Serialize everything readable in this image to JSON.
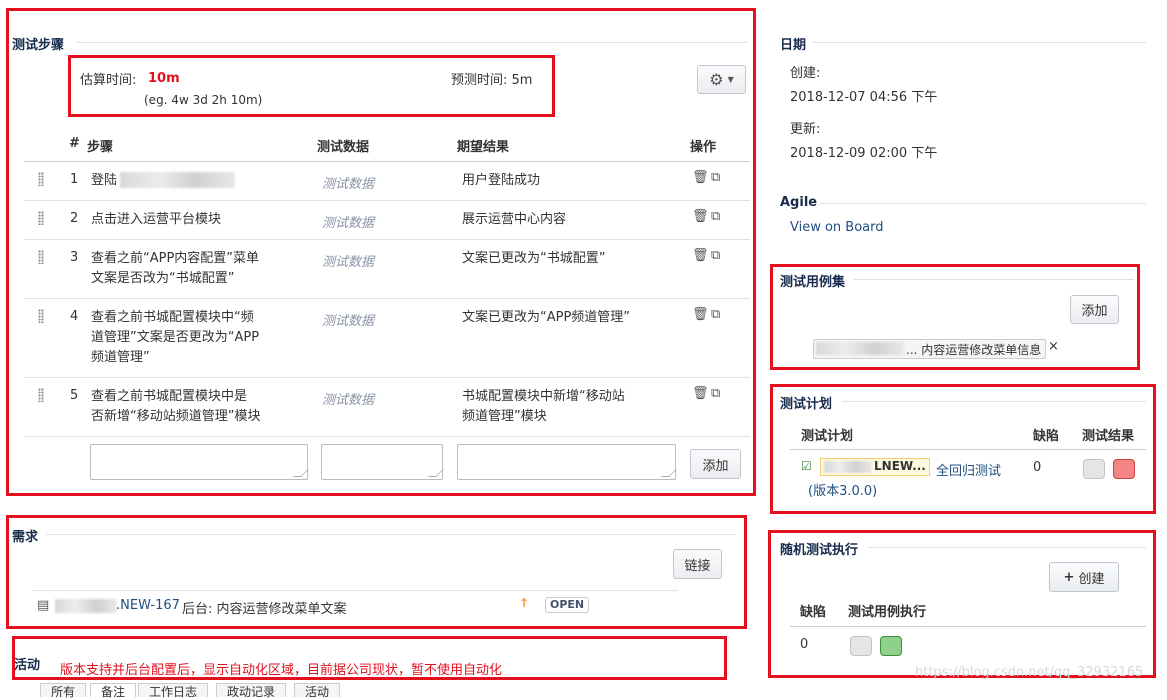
{
  "test_steps": {
    "title": "测试步骤",
    "estimate_label": "估算时间:",
    "estimate_value": "10m",
    "estimate_hint": "(eg. 4w 3d 2h 10m)",
    "forecast_label": "预测时间: 5m",
    "columns": {
      "num": "#",
      "step": "步骤",
      "data": "测试数据",
      "expected": "期望结果",
      "actions": "操作"
    },
    "rows": [
      {
        "num": "1",
        "step_lines": [
          "登陆"
        ],
        "data": "测试数据",
        "expected_lines": [
          "用户登陆成功"
        ]
      },
      {
        "num": "2",
        "step_lines": [
          "点击进入运营平台模块"
        ],
        "data": "测试数据",
        "expected_lines": [
          "展示运营中心内容"
        ]
      },
      {
        "num": "3",
        "step_lines": [
          "查看之前“APP内容配置”菜单",
          "文案是否改为“书城配置”"
        ],
        "data": "测试数据",
        "expected_lines": [
          "文案已更改为“书城配置”"
        ]
      },
      {
        "num": "4",
        "step_lines": [
          "查看之前书城配置模块中“频",
          "道管理”文案是否更改为“APP",
          "频道管理”"
        ],
        "data": "测试数据",
        "expected_lines": [
          "文案已更改为“APP频道管理”"
        ]
      },
      {
        "num": "5",
        "step_lines": [
          "查看之前书城配置模块中是",
          "否新增“移动站频道管理”模块"
        ],
        "data": "测试数据",
        "expected_lines": [
          "书城配置模块中新增“移动站",
          "频道管理”模块"
        ]
      }
    ],
    "add_button": "添加"
  },
  "requirements": {
    "title": "需求",
    "link_button": "链接",
    "issue_key": ".NEW-167",
    "issue_summary": "后台: 内容运营修改菜单文案",
    "status": "OPEN"
  },
  "activity": {
    "title": "活动",
    "note": "版本支持并后台配置后，显示自动化区域，目前据公司现状，暂不使用自动化",
    "tabs": [
      "所有",
      "备注",
      "工作日志",
      "政动记录",
      "活动"
    ]
  },
  "dates": {
    "title": "日期",
    "created_label": "创建:",
    "created_value": "2018-12-07 04:56 下午",
    "updated_label": "更新:",
    "updated_value": "2018-12-09 02:00 下午"
  },
  "agile": {
    "title": "Agile",
    "link": "View on Board"
  },
  "test_sets": {
    "title": "测试用例集",
    "add_button": "添加",
    "tag": "... 内容运营修改菜单信息",
    "remove": "×"
  },
  "test_plans": {
    "title": "测试计划",
    "col_plan": "测试计划",
    "col_defects": "缺陷",
    "col_result": "测试结果",
    "plan_key": "LNEW...",
    "plan_name": "全回归测试",
    "plan_version": "(版本3.0.0)",
    "defects": "0",
    "colors": {
      "result_fail": "#f48585",
      "result_none": "#e5e5e5"
    }
  },
  "adhoc": {
    "title": "随机测试执行",
    "create_button": "创建",
    "col_defects": "缺陷",
    "col_exec": "测试用例执行",
    "defects": "0",
    "colors": {
      "exec_pass": "#8fd18b",
      "exec_none": "#e5e5e5"
    }
  },
  "watermark": "https://blog.csdn.net/qq_32932165"
}
